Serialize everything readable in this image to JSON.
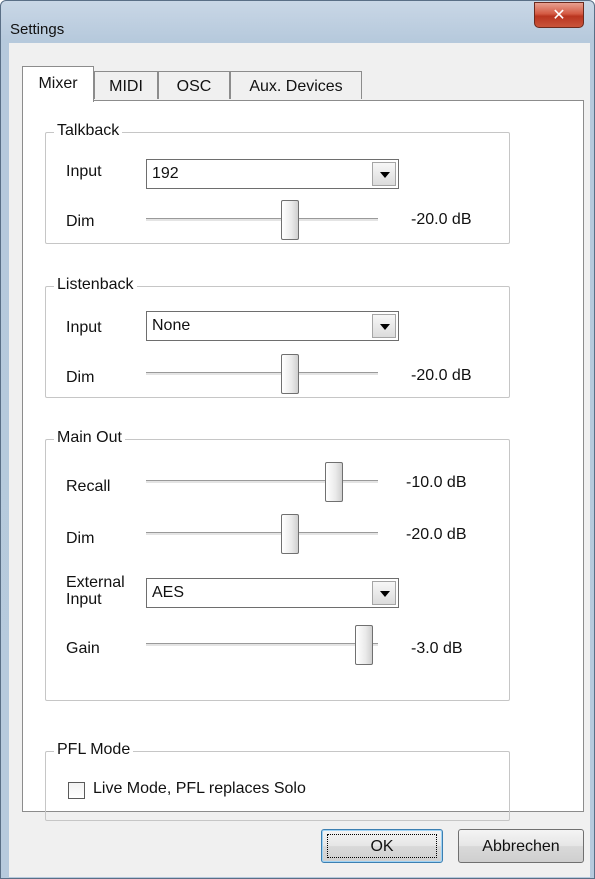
{
  "window": {
    "title": "Settings"
  },
  "tabs": [
    {
      "label": "Mixer",
      "active": true
    },
    {
      "label": "MIDI",
      "active": false
    },
    {
      "label": "OSC",
      "active": false
    },
    {
      "label": "Aux. Devices",
      "active": false
    }
  ],
  "talkback": {
    "title": "Talkback",
    "input_label": "Input",
    "input_value": "192",
    "dim_label": "Dim",
    "dim_value": "-20.0 dB",
    "dim_position": 0.62
  },
  "listenback": {
    "title": "Listenback",
    "input_label": "Input",
    "input_value": "None",
    "dim_label": "Dim",
    "dim_value": "-20.0 dB",
    "dim_position": 0.62
  },
  "main_out": {
    "title": "Main Out",
    "recall_label": "Recall",
    "recall_value": "-10.0 dB",
    "recall_position": 0.81,
    "dim_label": "Dim",
    "dim_value": "-20.0 dB",
    "dim_position": 0.62,
    "external_input_label_1": "External",
    "external_input_label_2": "Input",
    "external_input_value": "AES",
    "gain_label": "Gain",
    "gain_value": "-3.0 dB",
    "gain_position": 0.94
  },
  "pfl_mode": {
    "title": "PFL Mode",
    "checkbox_label": "Live Mode,  PFL replaces Solo",
    "checked": false
  },
  "buttons": {
    "ok": "OK",
    "cancel": "Abbrechen"
  },
  "colors": {
    "titlebar": "#b6c9dc",
    "close": "#c9543a",
    "dialog_bg": "#f0f0f0"
  }
}
